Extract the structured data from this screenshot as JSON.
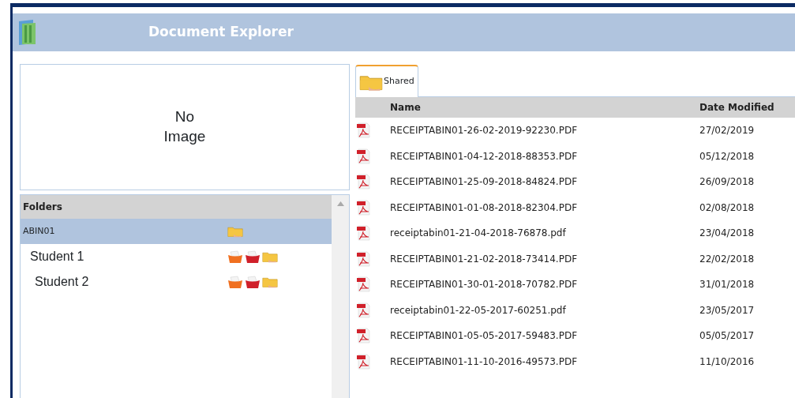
{
  "window": {
    "title": "Document Explorer"
  },
  "image_preview": {
    "text": "No Image"
  },
  "folders": {
    "heading": "Folders",
    "items": [
      {
        "label": "ABIN01",
        "kind": "root",
        "selected": true
      },
      {
        "label": "Student 1",
        "kind": "student",
        "selected": false
      },
      {
        "label": "Student 2",
        "kind": "student",
        "selected": false
      }
    ]
  },
  "tabs": [
    {
      "label": "Shared",
      "selected": true
    }
  ],
  "table": {
    "columns": [
      "Name",
      "Date Modified"
    ],
    "rows": [
      {
        "name": "RECEIPTABIN01-26-02-2019-92230.PDF",
        "date": "27/02/2019"
      },
      {
        "name": "RECEIPTABIN01-04-12-2018-88353.PDF",
        "date": "05/12/2018"
      },
      {
        "name": "RECEIPTABIN01-25-09-2018-84824.PDF",
        "date": "26/09/2018"
      },
      {
        "name": "RECEIPTABIN01-01-08-2018-82304.PDF",
        "date": "02/08/2018"
      },
      {
        "name": "receiptabin01-21-04-2018-76878.pdf",
        "date": "23/04/2018"
      },
      {
        "name": "RECEIPTABIN01-21-02-2018-73414.PDF",
        "date": "22/02/2018"
      },
      {
        "name": "RECEIPTABIN01-30-01-2018-70782.PDF",
        "date": "31/01/2018"
      },
      {
        "name": "receiptabin01-22-05-2017-60251.pdf",
        "date": "23/05/2017"
      },
      {
        "name": "RECEIPTABIN01-05-05-2017-59483.PDF",
        "date": "05/05/2017"
      },
      {
        "name": "RECEIPTABIN01-11-10-2016-49573.PDF",
        "date": "11/10/2016"
      }
    ]
  }
}
